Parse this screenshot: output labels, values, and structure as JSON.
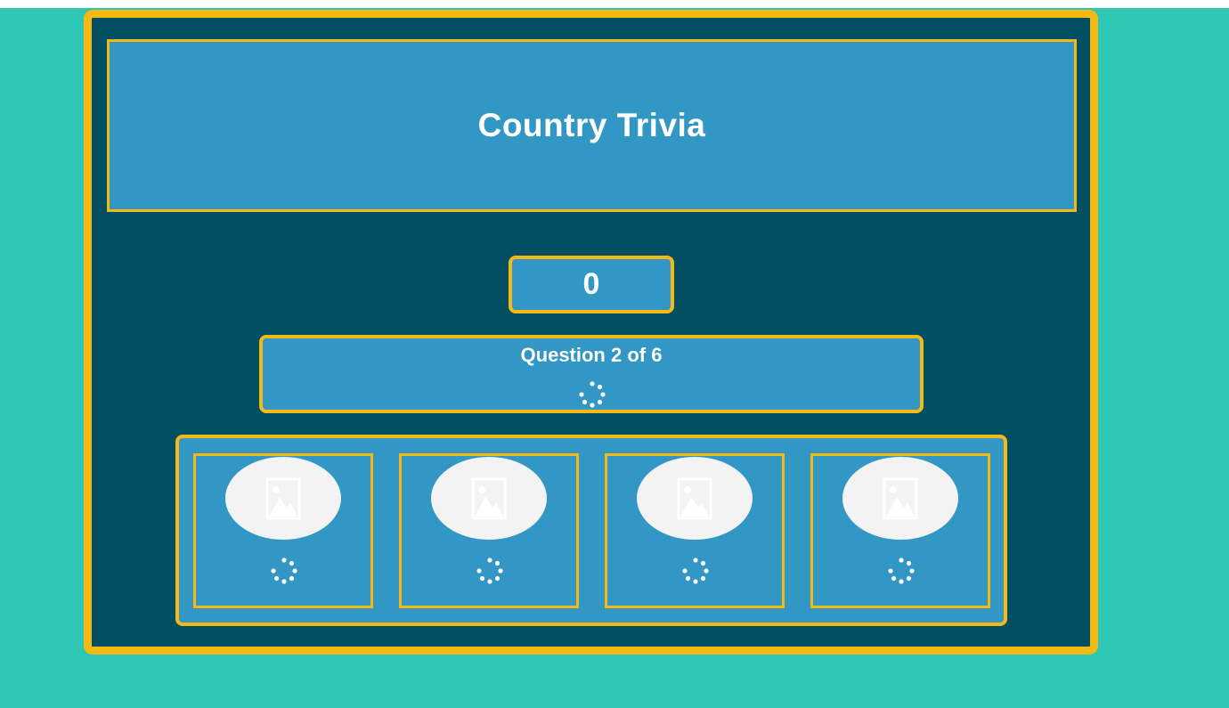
{
  "app": {
    "title": "Country Trivia",
    "score": "0",
    "question_label": "Question 2 of 6"
  },
  "answers": [
    {
      "image_icon": "image-placeholder-icon",
      "status": "loading-spinner-icon"
    },
    {
      "image_icon": "image-placeholder-icon",
      "status": "loading-spinner-icon"
    },
    {
      "image_icon": "image-placeholder-icon",
      "status": "loading-spinner-icon"
    },
    {
      "image_icon": "image-placeholder-icon",
      "status": "loading-spinner-icon"
    }
  ],
  "colors": {
    "page_background": "#2ec6b4",
    "frame_background": "#024e63",
    "panel_background": "#3297c4",
    "accent_border": "#f5b914",
    "text": "#ffffff",
    "image_placeholder": "#f3f3f3"
  }
}
